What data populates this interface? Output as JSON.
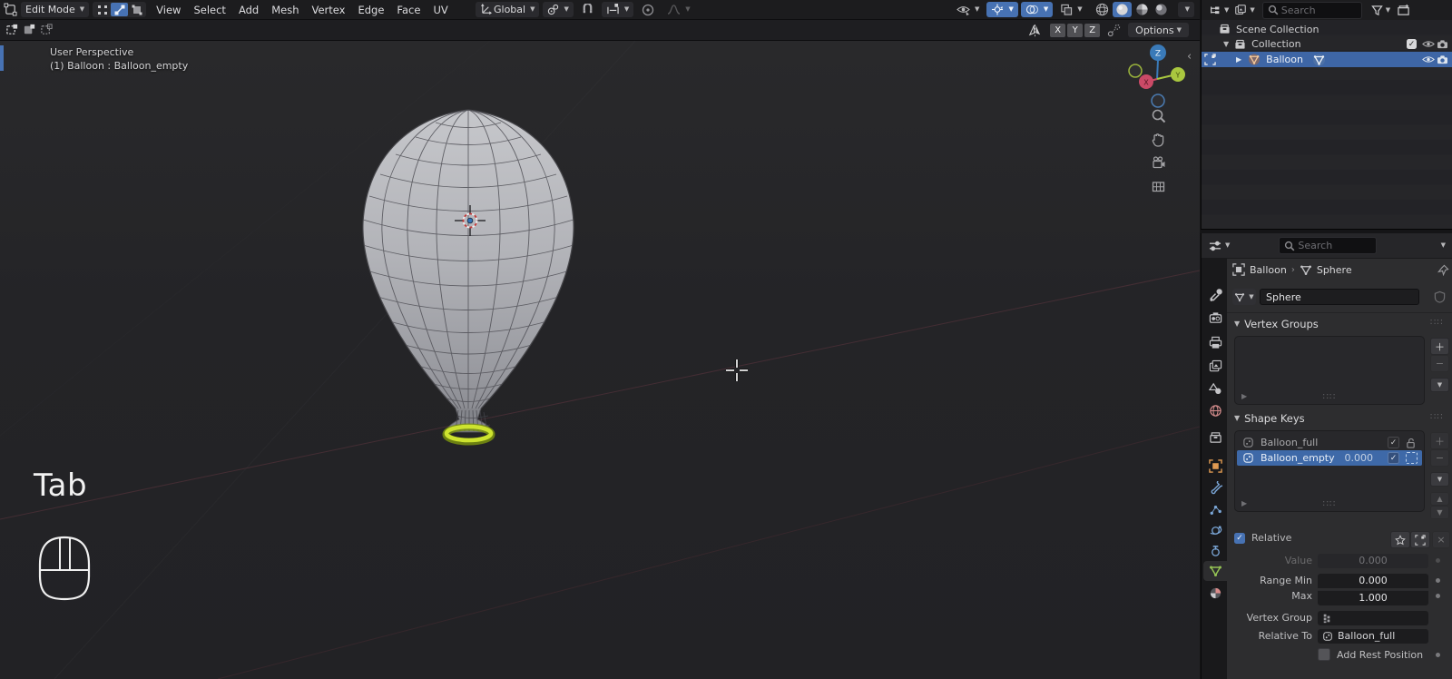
{
  "viewport": {
    "header": {
      "mode_label": "Edit Mode",
      "menus": [
        "View",
        "Select",
        "Add",
        "Mesh",
        "Vertex",
        "Edge",
        "Face",
        "UV"
      ],
      "orientation_label": "Global",
      "options_label": "Options",
      "axes": [
        "X",
        "Y",
        "Z"
      ]
    },
    "overlay": {
      "line1": "User Perspective",
      "line2": "(1) Balloon : Balloon_empty"
    },
    "gizmo": {
      "x": "X",
      "y": "Y",
      "z": "Z"
    },
    "screencast_key": "Tab"
  },
  "outliner": {
    "search_placeholder": "Search",
    "scene_collection_label": "Scene Collection",
    "collection_label": "Collection",
    "object_label": "Balloon"
  },
  "properties": {
    "search_placeholder": "Search",
    "breadcrumb_object": "Balloon",
    "breadcrumb_data": "Sphere",
    "data_name_value": "Sphere",
    "vertex_groups": {
      "title": "Vertex Groups"
    },
    "shape_keys": {
      "title": "Shape Keys",
      "key1_name": "Balloon_full",
      "key2_name": "Balloon_empty",
      "key2_value": "0.000",
      "relative_label": "Relative",
      "value_label": "Value",
      "value_value": "0.000",
      "range_min_label": "Range Min",
      "range_min_value": "0.000",
      "max_label": "Max",
      "max_value": "1.000",
      "vertex_group_label": "Vertex Group",
      "relative_to_label": "Relative To",
      "relative_to_value": "Balloon_full",
      "add_rest_label": "Add Rest Position"
    }
  },
  "colors": {
    "accent": "#4772b3",
    "selection": "#3e66a6",
    "selected_ring": "#cde32f"
  }
}
